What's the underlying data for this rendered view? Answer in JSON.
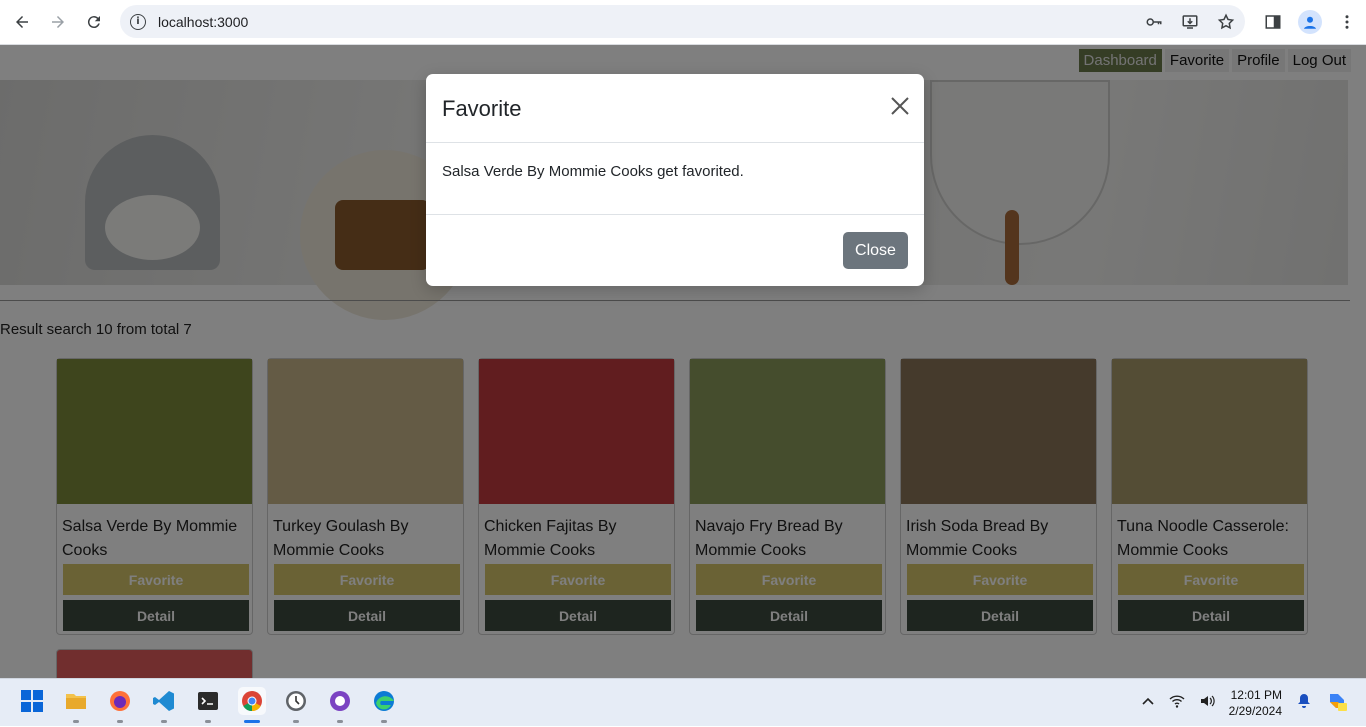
{
  "browser": {
    "url": "localhost:3000",
    "icons": [
      "back-icon",
      "forward-icon",
      "reload-icon",
      "site-info-icon",
      "key-icon",
      "install-app-icon",
      "star-icon",
      "side-panel-icon",
      "profile-icon",
      "menu-icon"
    ]
  },
  "nav": {
    "items": [
      {
        "label": "Dashboard",
        "active": true
      },
      {
        "label": "Favorite",
        "active": false
      },
      {
        "label": "Profile",
        "active": false
      },
      {
        "label": "Log Out",
        "active": false
      }
    ]
  },
  "results": {
    "summary": "Result search 10 from total 7"
  },
  "cards": [
    {
      "title": "Salsa Verde By Mommie Cooks",
      "favorite_label": "Favorite",
      "detail_label": "Detail",
      "img_color": "#7d8a3a"
    },
    {
      "title": "Turkey Goulash By Mommie Cooks",
      "favorite_label": "Favorite",
      "detail_label": "Detail",
      "img_color": "#c9b68a"
    },
    {
      "title": "Chicken Fajitas By Mommie Cooks",
      "favorite_label": "Favorite",
      "detail_label": "Detail",
      "img_color": "#c23a3f"
    },
    {
      "title": "Navajo Fry Bread By Mommie Cooks",
      "favorite_label": "Favorite",
      "detail_label": "Detail",
      "img_color": "#8a9a5a"
    },
    {
      "title": "Irish Soda Bread By Mommie Cooks",
      "favorite_label": "Favorite",
      "detail_label": "Detail",
      "img_color": "#8a7458"
    },
    {
      "title": "Tuna Noodle Casserole: Mommie Cooks",
      "favorite_label": "Favorite",
      "detail_label": "Detail",
      "img_color": "#a89a6a"
    }
  ],
  "modal": {
    "title": "Favorite",
    "message": "Salsa Verde By Mommie Cooks get favorited.",
    "close_label": "Close"
  },
  "taskbar": {
    "apps": [
      "windows-start-icon",
      "file-explorer-icon",
      "firefox-icon",
      "vscode-icon",
      "terminal-icon",
      "chrome-icon",
      "clock-app-icon",
      "github-desktop-icon",
      "edge-icon"
    ],
    "active_app": "chrome-icon",
    "time": "12:01 PM",
    "date": "2/29/2024"
  },
  "colors": {
    "favorite_button": "#d4c46a",
    "detail_button": "#3d4a3e",
    "nav_active": "#6b7b4b",
    "modal_close": "#6c757d"
  }
}
